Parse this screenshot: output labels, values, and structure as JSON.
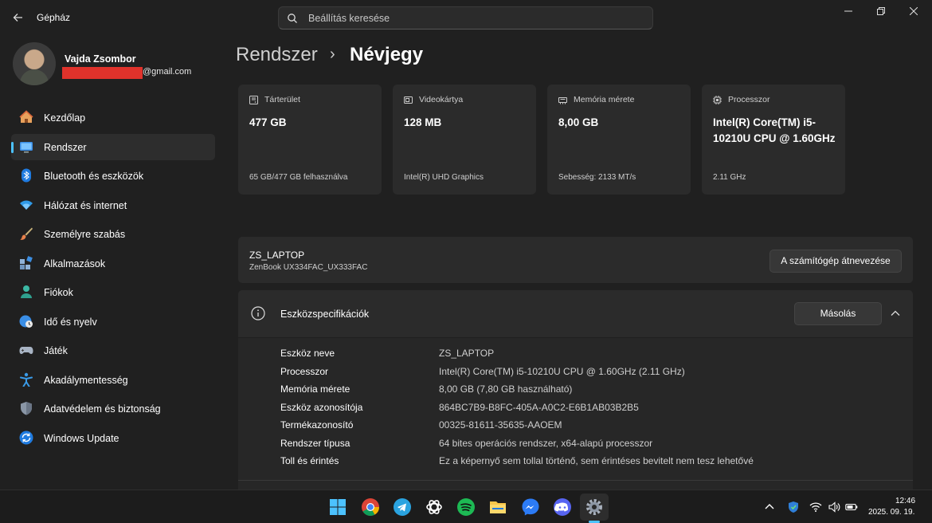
{
  "window": {
    "title": "Gépház",
    "search_placeholder": "Beállítás keresése",
    "controls": [
      "minimize",
      "maximize",
      "close"
    ]
  },
  "profile": {
    "name": "Vajda Zsombor",
    "email_suffix": "@gmail.com"
  },
  "sidebar": {
    "items": [
      {
        "label": "Kezdőlap",
        "icon": "home-icon",
        "active": false
      },
      {
        "label": "Rendszer",
        "icon": "system-icon",
        "active": true
      },
      {
        "label": "Bluetooth és eszközök",
        "icon": "bluetooth-icon",
        "active": false
      },
      {
        "label": "Hálózat és internet",
        "icon": "wifi-icon",
        "active": false
      },
      {
        "label": "Személyre szabás",
        "icon": "brush-icon",
        "active": false
      },
      {
        "label": "Alkalmazások",
        "icon": "apps-icon",
        "active": false
      },
      {
        "label": "Fiókok",
        "icon": "person-icon",
        "active": false
      },
      {
        "label": "Idő és nyelv",
        "icon": "globe-clock-icon",
        "active": false
      },
      {
        "label": "Játék",
        "icon": "gamepad-icon",
        "active": false
      },
      {
        "label": "Akadálymentesség",
        "icon": "accessibility-icon",
        "active": false
      },
      {
        "label": "Adatvédelem és biztonság",
        "icon": "shield-icon",
        "active": false
      },
      {
        "label": "Windows Update",
        "icon": "update-icon",
        "active": false
      }
    ]
  },
  "breadcrumb": {
    "parent": "Rendszer",
    "separator": "›",
    "current": "Névjegy"
  },
  "cards": [
    {
      "title": "Tárterület",
      "value": "477 GB",
      "sub": "65 GB/477 GB felhasználva",
      "icon": "storage-icon"
    },
    {
      "title": "Videokártya",
      "value": "128 MB",
      "sub": "Intel(R) UHD Graphics",
      "icon": "gpu-icon"
    },
    {
      "title": "Memória mérete",
      "value": "8,00 GB",
      "sub": "Sebesség: 2133 MT/s",
      "icon": "memory-icon"
    },
    {
      "title": "Processzor",
      "value": "Intel(R) Core(TM) i5-10210U CPU @ 1.60GHz",
      "sub": "2.11 GHz",
      "icon": "cpu-icon"
    }
  ],
  "device": {
    "name": "ZS_LAPTOP",
    "model": "ZenBook UX334FAC_UX333FAC",
    "rename_label": "A számítógép átnevezése"
  },
  "specs": {
    "title": "Eszközspecifikációk",
    "copy_label": "Másolás",
    "rows": [
      {
        "key": "Eszköz neve",
        "value": "ZS_LAPTOP"
      },
      {
        "key": "Processzor",
        "value": "Intel(R) Core(TM) i5-10210U CPU @ 1.60GHz (2.11 GHz)"
      },
      {
        "key": "Memória mérete",
        "value": "8,00 GB (7,80 GB használható)"
      },
      {
        "key": "Eszköz azonosítója",
        "value": "864BC7B9-B8FC-405A-A0C2-E6B1AB03B2B5"
      },
      {
        "key": "Termékazonosító",
        "value": "00325-81611-35635-AAOEM"
      },
      {
        "key": "Rendszer típusa",
        "value": "64 bites operációs rendszer, x64-alapú processzor"
      },
      {
        "key": "Toll és érintés",
        "value": "Ez a képernyő sem tollal történő, sem érintéses bevitelt nem tesz lehetővé"
      }
    ]
  },
  "taskbar": {
    "apps": [
      "windows-start-icon",
      "chrome-icon",
      "telegram-icon",
      "chatgpt-icon",
      "spotify-icon",
      "file-explorer-icon",
      "messenger-icon",
      "discord-icon",
      "settings-icon"
    ],
    "time": "12:46",
    "date": "2025. 09. 19."
  },
  "colors": {
    "accent": "#4cc2ff",
    "background": "#202020",
    "card": "#2b2b2b",
    "taskbar": "#1c1c1c"
  }
}
